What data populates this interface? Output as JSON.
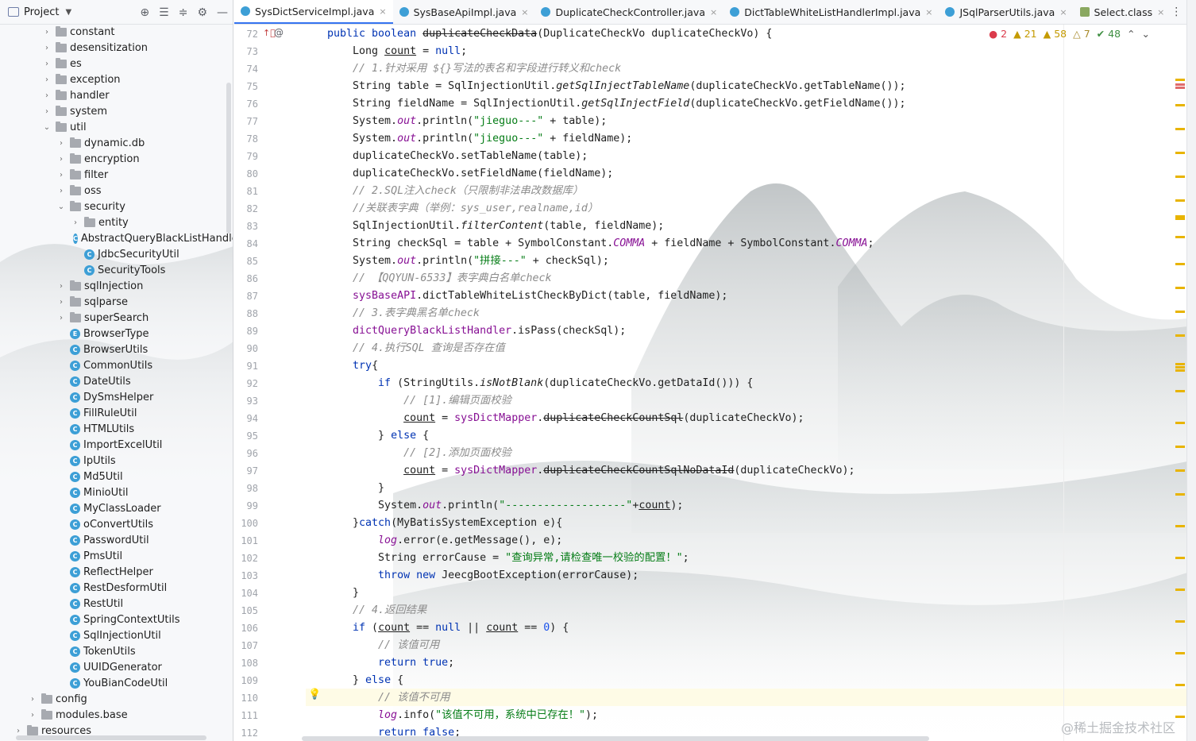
{
  "project_panel": {
    "title": "Project",
    "tree": [
      {
        "label": "constant",
        "type": "folder",
        "depth": 0,
        "expanded": false
      },
      {
        "label": "desensitization",
        "type": "folder",
        "depth": 0,
        "expanded": false
      },
      {
        "label": "es",
        "type": "folder",
        "depth": 0,
        "expanded": false
      },
      {
        "label": "exception",
        "type": "folder",
        "depth": 0,
        "expanded": false
      },
      {
        "label": "handler",
        "type": "folder",
        "depth": 0,
        "expanded": false
      },
      {
        "label": "system",
        "type": "folder",
        "depth": 0,
        "expanded": false
      },
      {
        "label": "util",
        "type": "folder",
        "depth": 0,
        "expanded": true
      },
      {
        "label": "dynamic.db",
        "type": "folder",
        "depth": 1,
        "expanded": false
      },
      {
        "label": "encryption",
        "type": "folder",
        "depth": 1,
        "expanded": false
      },
      {
        "label": "filter",
        "type": "folder",
        "depth": 1,
        "expanded": false
      },
      {
        "label": "oss",
        "type": "folder",
        "depth": 1,
        "expanded": false
      },
      {
        "label": "security",
        "type": "folder",
        "depth": 1,
        "expanded": true
      },
      {
        "label": "entity",
        "type": "folder",
        "depth": 2,
        "expanded": false
      },
      {
        "label": "AbstractQueryBlackListHandle",
        "type": "class",
        "depth": 2
      },
      {
        "label": "JdbcSecurityUtil",
        "type": "class",
        "depth": 2
      },
      {
        "label": "SecurityTools",
        "type": "class",
        "depth": 2
      },
      {
        "label": "sqlInjection",
        "type": "folder",
        "depth": 1,
        "expanded": false
      },
      {
        "label": "sqlparse",
        "type": "folder",
        "depth": 1,
        "expanded": false
      },
      {
        "label": "superSearch",
        "type": "folder",
        "depth": 1,
        "expanded": false
      },
      {
        "label": "BrowserType",
        "type": "enum",
        "depth": 1
      },
      {
        "label": "BrowserUtils",
        "type": "class",
        "depth": 1
      },
      {
        "label": "CommonUtils",
        "type": "class",
        "depth": 1
      },
      {
        "label": "DateUtils",
        "type": "class",
        "depth": 1
      },
      {
        "label": "DySmsHelper",
        "type": "class",
        "depth": 1
      },
      {
        "label": "FillRuleUtil",
        "type": "class",
        "depth": 1
      },
      {
        "label": "HTMLUtils",
        "type": "class",
        "depth": 1
      },
      {
        "label": "ImportExcelUtil",
        "type": "class",
        "depth": 1
      },
      {
        "label": "IpUtils",
        "type": "class",
        "depth": 1
      },
      {
        "label": "Md5Util",
        "type": "class",
        "depth": 1
      },
      {
        "label": "MinioUtil",
        "type": "class",
        "depth": 1
      },
      {
        "label": "MyClassLoader",
        "type": "class",
        "depth": 1
      },
      {
        "label": "oConvertUtils",
        "type": "class",
        "depth": 1
      },
      {
        "label": "PasswordUtil",
        "type": "class",
        "depth": 1
      },
      {
        "label": "PmsUtil",
        "type": "class",
        "depth": 1
      },
      {
        "label": "ReflectHelper",
        "type": "class",
        "depth": 1
      },
      {
        "label": "RestDesformUtil",
        "type": "class",
        "depth": 1
      },
      {
        "label": "RestUtil",
        "type": "class",
        "depth": 1
      },
      {
        "label": "SpringContextUtils",
        "type": "class",
        "depth": 1
      },
      {
        "label": "SqlInjectionUtil",
        "type": "class",
        "depth": 1
      },
      {
        "label": "TokenUtils",
        "type": "class",
        "depth": 1
      },
      {
        "label": "UUIDGenerator",
        "type": "class",
        "depth": 1
      },
      {
        "label": "YouBianCodeUtil",
        "type": "class",
        "depth": 1
      },
      {
        "label": "config",
        "type": "folder",
        "depth": -1,
        "expanded": false
      },
      {
        "label": "modules.base",
        "type": "folder",
        "depth": -1,
        "expanded": false
      },
      {
        "label": "resources",
        "type": "folder",
        "depth": -2,
        "expanded": false
      }
    ]
  },
  "tabs": [
    {
      "label": "SysDictServiceImpl.java",
      "active": true,
      "icon": "class-icon"
    },
    {
      "label": "SysBaseApiImpl.java",
      "active": false,
      "icon": "class-icon"
    },
    {
      "label": "DuplicateCheckController.java",
      "active": false,
      "icon": "class-icon"
    },
    {
      "label": "DictTableWhiteListHandlerImpl.java",
      "active": false,
      "icon": "class-icon"
    },
    {
      "label": "JSqlParserUtils.java",
      "active": false,
      "icon": "class-icon"
    },
    {
      "label": "Select.class",
      "active": false,
      "icon": "bytecode-icon"
    }
  ],
  "inspection": {
    "errors": "2",
    "warnings": "21",
    "weak_warnings": "58",
    "typos": "7",
    "ok": "48"
  },
  "editor": {
    "current_line": 110,
    "lines": [
      {
        "n": 72,
        "html": "<span class=\"kw\">public boolean</span> <span class=\"strike\">duplicateCheckData</span>(DuplicateCheckVo duplicateCheckVo) {"
      },
      {
        "n": 73,
        "html": "    Long <span class=\"ul\">count</span> = <span class=\"kw\">null</span>;"
      },
      {
        "n": 74,
        "html": "    <span class=\"cmt\">// 1.针对采用 ${}写法的表名和字段进行转义和check</span>"
      },
      {
        "n": 75,
        "html": "    String table = SqlInjectionUtil.<span class=\"meth-i\">getSqlInjectTableName</span>(duplicateCheckVo.getTableName());"
      },
      {
        "n": 76,
        "html": "    String fieldName = SqlInjectionUtil.<span class=\"meth-i\">getSqlInjectField</span>(duplicateCheckVo.getFieldName());"
      },
      {
        "n": 77,
        "html": "    System.<span class=\"stat\">out</span>.println(<span class=\"str\">\"jieguo---\"</span> + table);"
      },
      {
        "n": 78,
        "html": "    System.<span class=\"stat\">out</span>.println(<span class=\"str\">\"jieguo---\"</span> + fieldName);"
      },
      {
        "n": 79,
        "html": "    duplicateCheckVo.setTableName(table);"
      },
      {
        "n": 80,
        "html": "    duplicateCheckVo.setFieldName(fieldName);"
      },
      {
        "n": 81,
        "html": "    <span class=\"cmt\">// 2.SQL注入check（只限制非法串改数据库）</span>"
      },
      {
        "n": 82,
        "html": "    <span class=\"cmt\">//关联表字典（举例：sys_user,realname,id）</span>"
      },
      {
        "n": 83,
        "html": "    SqlInjectionUtil.<span class=\"meth-i\">filterContent</span>(table, fieldName);"
      },
      {
        "n": 84,
        "html": "    String checkSql = table + SymbolConstant.<span class=\"stat\">COMMA</span> + fieldName + SymbolConstant.<span class=\"stat\">COMMA</span>;"
      },
      {
        "n": 85,
        "html": "    System.<span class=\"stat\">out</span>.println(<span class=\"str\">\"拼接---\"</span> + checkSql);"
      },
      {
        "n": 86,
        "html": "    <span class=\"cmt\">// 【QQYUN-6533】表字典白名单check</span>"
      },
      {
        "n": 87,
        "html": "    <span class=\"fld\">sysBaseAPI</span>.dictTableWhiteListCheckByDict(table, fieldName);"
      },
      {
        "n": 88,
        "html": "    <span class=\"cmt\">// 3.表字典黑名单check</span>"
      },
      {
        "n": 89,
        "html": "    <span class=\"fld\">dictQueryBlackListHandler</span>.isPass(checkSql);"
      },
      {
        "n": 90,
        "html": "    <span class=\"cmt\">// 4.执行SQL 查询是否存在值</span>"
      },
      {
        "n": 91,
        "html": "    <span class=\"kw\">try</span>{"
      },
      {
        "n": 92,
        "html": "        <span class=\"kw\">if</span> (StringUtils.<span class=\"meth-i\">isNotBlank</span>(duplicateCheckVo.getDataId())) {"
      },
      {
        "n": 93,
        "html": "            <span class=\"cmt\">// [1].编辑页面校验</span>"
      },
      {
        "n": 94,
        "html": "            <span class=\"ul\">count</span> = <span class=\"fld\">sysDictMapper</span>.<span class=\"strike\">duplicateCheckCountSql</span>(duplicateCheckVo);"
      },
      {
        "n": 95,
        "html": "        } <span class=\"kw\">else</span> {"
      },
      {
        "n": 96,
        "html": "            <span class=\"cmt\">// [2].添加页面校验</span>"
      },
      {
        "n": 97,
        "html": "            <span class=\"ul\">count</span> = <span class=\"fld\">sysDictMapper</span>.<span class=\"strike\">duplicateCheckCountSqlNoDataId</span>(duplicateCheckVo);"
      },
      {
        "n": 98,
        "html": "        }"
      },
      {
        "n": 99,
        "html": "        System.<span class=\"stat\">out</span>.println(<span class=\"str\">\"-------------------\"</span>+<span class=\"ul\">count</span>);"
      },
      {
        "n": 100,
        "html": "    }<span class=\"kw\">catch</span>(MyBatisSystemException e){"
      },
      {
        "n": 101,
        "html": "        <span class=\"stat\">log</span>.error(e.getMessage(), e);"
      },
      {
        "n": 102,
        "html": "        String errorCause = <span class=\"str\">\"查询异常,请检查唯一校验的配置！\"</span>;"
      },
      {
        "n": 103,
        "html": "        <span class=\"kw\">throw new</span> JeecgBootException(errorCause);"
      },
      {
        "n": 104,
        "html": "    }"
      },
      {
        "n": 105,
        "html": "    <span class=\"cmt\">// 4.返回结果</span>"
      },
      {
        "n": 106,
        "html": "    <span class=\"kw\">if</span> (<span class=\"ul\">count</span> == <span class=\"kw\">null</span> || <span class=\"ul\">count</span> == <span class=\"num\">0</span>) {"
      },
      {
        "n": 107,
        "html": "        <span class=\"cmt\">// 该值可用</span>"
      },
      {
        "n": 108,
        "html": "        <span class=\"kw\">return true</span>;"
      },
      {
        "n": 109,
        "html": "    } <span class=\"kw\">else</span> {"
      },
      {
        "n": 110,
        "html": "        <span class=\"cmt\">// 该值不可用</span>"
      },
      {
        "n": 111,
        "html": "        <span class=\"stat\">log</span>.info(<span class=\"str\">\"该值不可用，系统中已存在！\"</span>);"
      },
      {
        "n": 112,
        "html": "        <span class=\"kw\">return false</span>;"
      }
    ]
  },
  "watermark": "@稀土掘金技术社区"
}
